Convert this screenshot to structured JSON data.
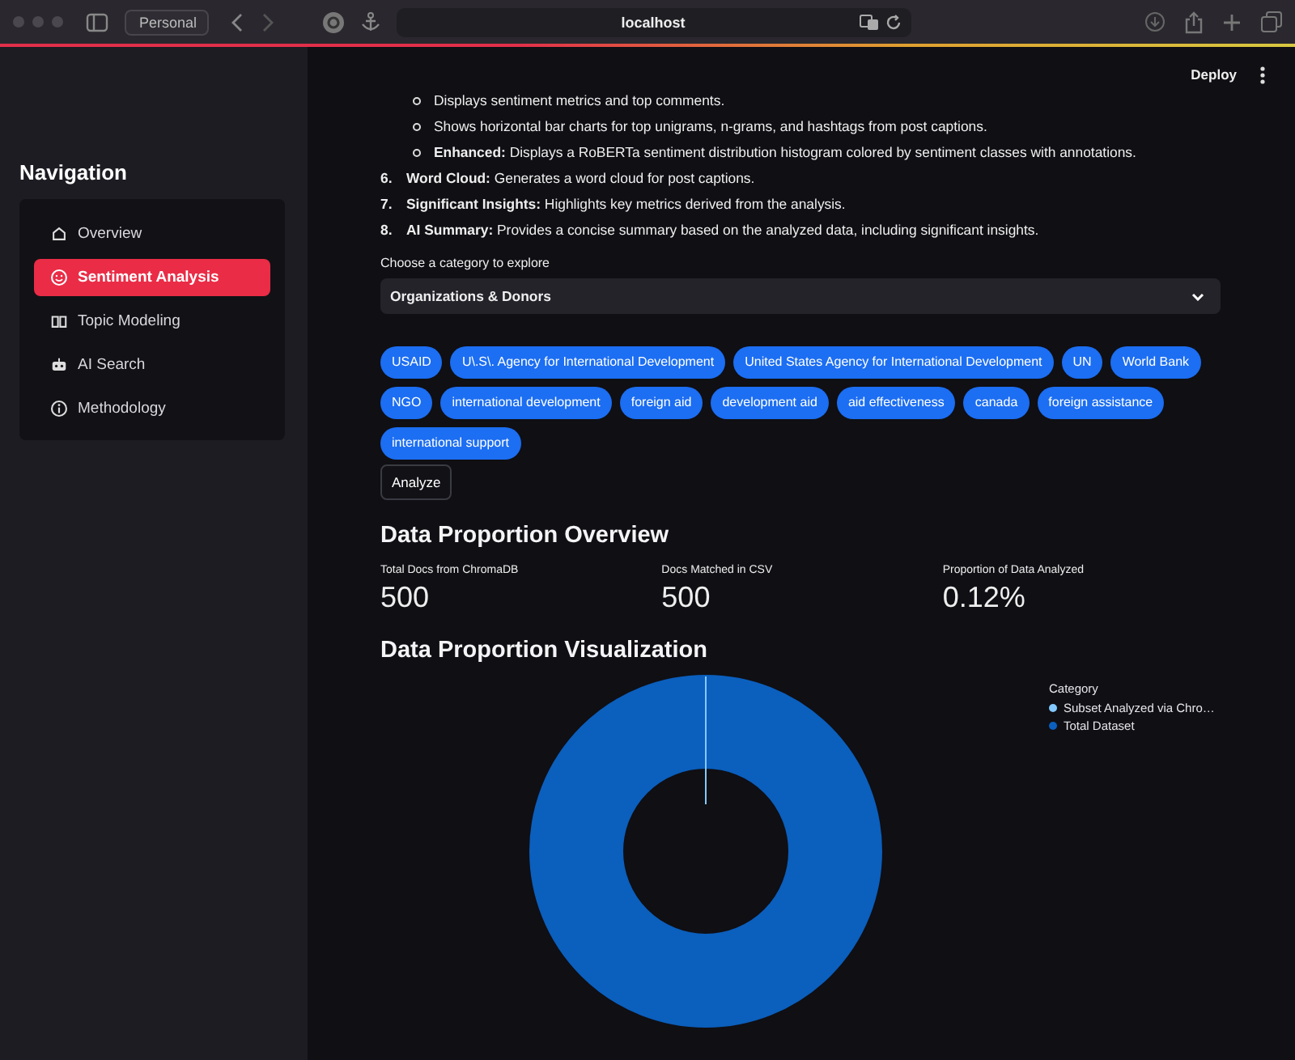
{
  "browser": {
    "profile": "Personal",
    "url": "localhost"
  },
  "header": {
    "deploy": "Deploy"
  },
  "sidebar": {
    "title": "Navigation",
    "items": [
      {
        "label": "Overview",
        "kind": "home",
        "selected": false
      },
      {
        "label": "Sentiment Analysis",
        "kind": "smile",
        "selected": true
      },
      {
        "label": "Topic Modeling",
        "kind": "book",
        "selected": false
      },
      {
        "label": "AI Search",
        "kind": "robot",
        "selected": false
      },
      {
        "label": "Methodology",
        "kind": "info",
        "selected": false
      }
    ]
  },
  "list": [
    {
      "kind": "bullet",
      "text": "Displays sentiment metrics and top comments."
    },
    {
      "kind": "bullet",
      "text": "Shows horizontal bar charts for top unigrams, n-grams, and hashtags from post captions."
    },
    {
      "kind": "bullet",
      "text": "**Enhanced:** Displays a RoBERTa sentiment distribution histogram colored by sentiment classes with annotations."
    },
    {
      "kind": "numbered",
      "number": "6.",
      "text": "**Word Cloud:** Generates a word cloud for post captions."
    },
    {
      "kind": "numbered",
      "number": "7.",
      "text": "**Significant Insights:** Highlights key metrics derived from the analysis."
    },
    {
      "kind": "numbered",
      "number": "8.",
      "text": "**AI Summary:** Provides a concise summary based on the analyzed data, including significant insights."
    }
  ],
  "category_select": {
    "label": "Choose a category to explore",
    "value": "Organizations & Donors"
  },
  "keywords": [
    "USAID",
    "U\\.S\\. Agency for International Development",
    "United States Agency for International Development",
    "UN",
    "World Bank",
    "NGO",
    "international development",
    "foreign aid",
    "development aid",
    "aid effectiveness",
    "canada",
    "foreign assistance",
    "international support"
  ],
  "analyze_button": "Analyze",
  "overview": {
    "title": "Data Proportion Overview",
    "metrics": [
      {
        "label": "Total Docs from ChromaDB",
        "value": "500"
      },
      {
        "label": "Docs Matched in CSV",
        "value": "500"
      },
      {
        "label": "Proportion of Data Analyzed",
        "value": "0.12%"
      }
    ]
  },
  "visualization": {
    "title": "Data Proportion Visualization",
    "legend_title": "Category",
    "legend": [
      {
        "label": "Subset Analyzed via Chro…",
        "color": "#83c9ff"
      },
      {
        "label": "Total Dataset",
        "color": "#0b5fbd"
      }
    ]
  }
}
